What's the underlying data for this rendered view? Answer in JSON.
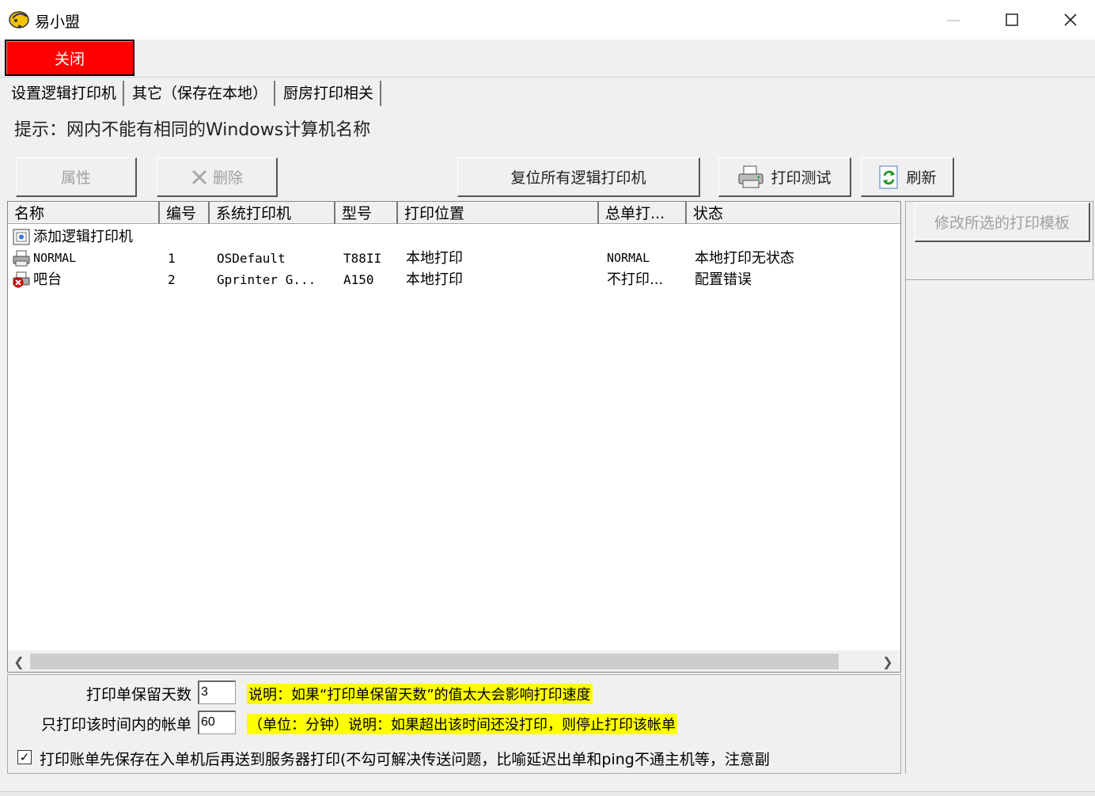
{
  "window": {
    "title": "易小盟",
    "minimize_glyph": "—",
    "maximize_glyph": "☐",
    "close_glyph": "✕"
  },
  "toolbar": {
    "close_label": "关闭"
  },
  "tabs": [
    {
      "label": "设置逻辑打印机",
      "active": true
    },
    {
      "label": "其它（保存在本地）",
      "active": false
    },
    {
      "label": "厨房打印相关",
      "active": false
    }
  ],
  "hint": "提示：网内不能有相同的Windows计算机名称",
  "buttons": {
    "properties": "属性",
    "delete": "删除",
    "reset_all": "复位所有逻辑打印机",
    "print_test": "打印测试",
    "refresh": "刷新",
    "modify_template": "修改所选的打印模板"
  },
  "columns": [
    "名称",
    "编号",
    "系统打印机",
    "型号",
    "打印位置",
    "总单打...",
    "状态"
  ],
  "rows": [
    {
      "icon": "add-printer-icon",
      "name": "添加逻辑打印机",
      "num": "",
      "sys": "",
      "model": "",
      "location": "",
      "total": "",
      "status": ""
    },
    {
      "icon": "printer-icon",
      "name": "NORMAL",
      "num": "1",
      "sys": "OSDefault",
      "model": "T88II",
      "location": "本地打印",
      "total": "NORMAL",
      "status": "本地打印无状态"
    },
    {
      "icon": "printer-error-icon",
      "name": "吧台",
      "num": "2",
      "sys": "Gprinter  G...",
      "model": "A150",
      "location": "本地打印",
      "total": "不打印...",
      "status": "配置错误"
    }
  ],
  "settings": {
    "keep_days_label": "打印单保留天数",
    "keep_days_value": "3",
    "keep_days_note": "说明：如果“打印单保留天数”的值太大会影响打印速度",
    "time_limit_label": "只打印该时间内的帐单",
    "time_limit_value": "60",
    "time_limit_note": "（单位：分钟）说明：如果超出该时间还没打印，则停止打印该帐单",
    "save_first_checked": true,
    "save_first_label": "打印账单先保存在入单机后再送到服务器打印(不勾可解决传送问题，比喻延迟出单和ping不通主机等，注意副"
  },
  "colors": {
    "close_button": "#ff0000",
    "note_highlight": "#ffff00"
  }
}
